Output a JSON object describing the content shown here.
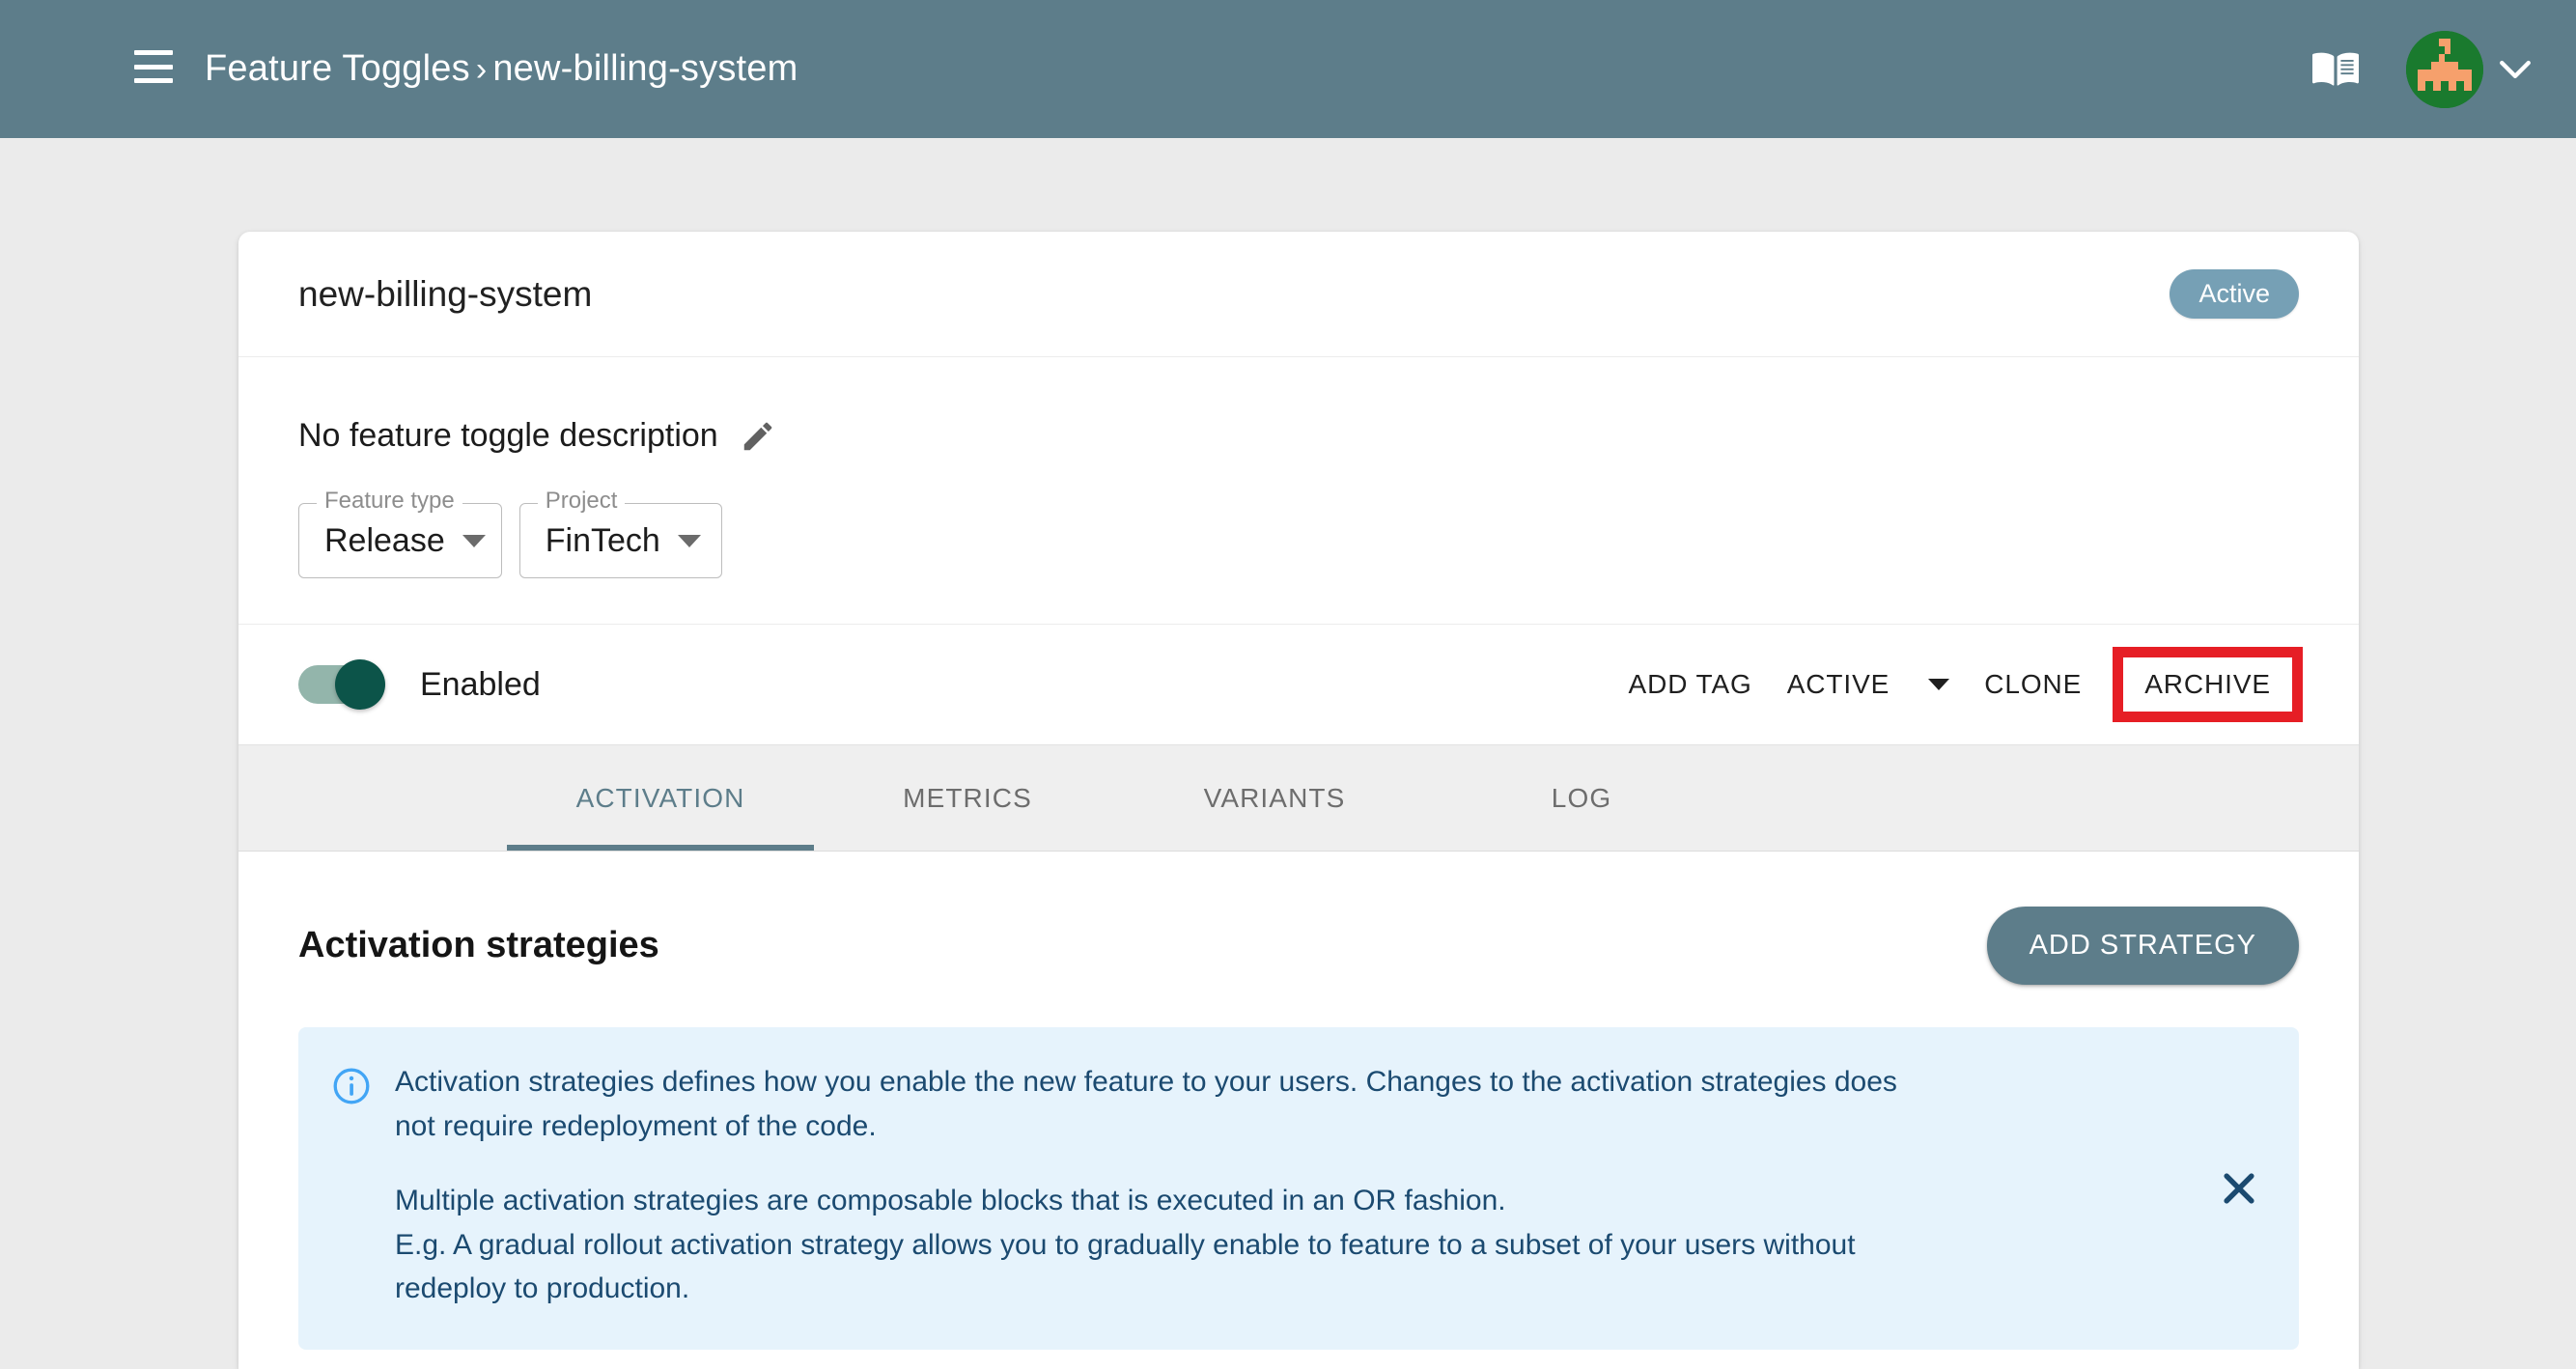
{
  "appbar": {
    "menu_icon": "hamburger-menu-icon",
    "breadcrumb_root": "Feature Toggles",
    "breadcrumb_separator": "›",
    "breadcrumb_current": "new-billing-system",
    "docs_icon": "book-icon",
    "avatar_icon": "user-avatar",
    "profile_chevron_icon": "chevron-down-icon",
    "bg_color": "#5d7d8a"
  },
  "card": {
    "title": "new-billing-system",
    "status_chip": "Active",
    "status_chip_color": "#76a0b5",
    "description": "No feature toggle description",
    "edit_icon": "pencil-icon",
    "selects": [
      {
        "label": "Feature type",
        "value": "Release",
        "caret_icon": "caret-down-icon"
      },
      {
        "label": "Project",
        "value": "FinTech",
        "caret_icon": "caret-down-icon"
      }
    ],
    "toggle": {
      "label": "Enabled",
      "state": "on",
      "track_color": "#93b5ab",
      "thumb_color": "#0c5449"
    },
    "actions": {
      "add_tag": "ADD TAG",
      "active": "ACTIVE",
      "active_caret_icon": "caret-down-icon",
      "clone": "CLONE",
      "archive": "ARCHIVE",
      "archive_highlight_color": "#e61e25"
    }
  },
  "tabs": {
    "items": [
      {
        "label": "ACTIVATION",
        "active": true
      },
      {
        "label": "METRICS",
        "active": false
      },
      {
        "label": "VARIANTS",
        "active": false
      },
      {
        "label": "LOG",
        "active": false
      }
    ],
    "active_color": "#5d7d8a"
  },
  "strategies": {
    "title": "Activation strategies",
    "add_button": "ADD STRATEGY",
    "add_button_color": "#5d7d8a",
    "alert": {
      "icon": "info-circle-icon",
      "icon_color": "#42a5f5",
      "bg_color": "#e6f3fc",
      "text_color": "#1b4a70",
      "paragraph_1": "Activation strategies defines how you enable the new feature to your users. Changes to the activation strategies does not require redeployment of the code.",
      "paragraph_2": "Multiple activation strategies are composable blocks that is executed in an OR fashion.",
      "paragraph_3": "E.g. A gradual rollout activation strategy allows you to gradually enable to feature to a subset of your users without redeploy to production.",
      "close_icon": "close-icon"
    }
  }
}
